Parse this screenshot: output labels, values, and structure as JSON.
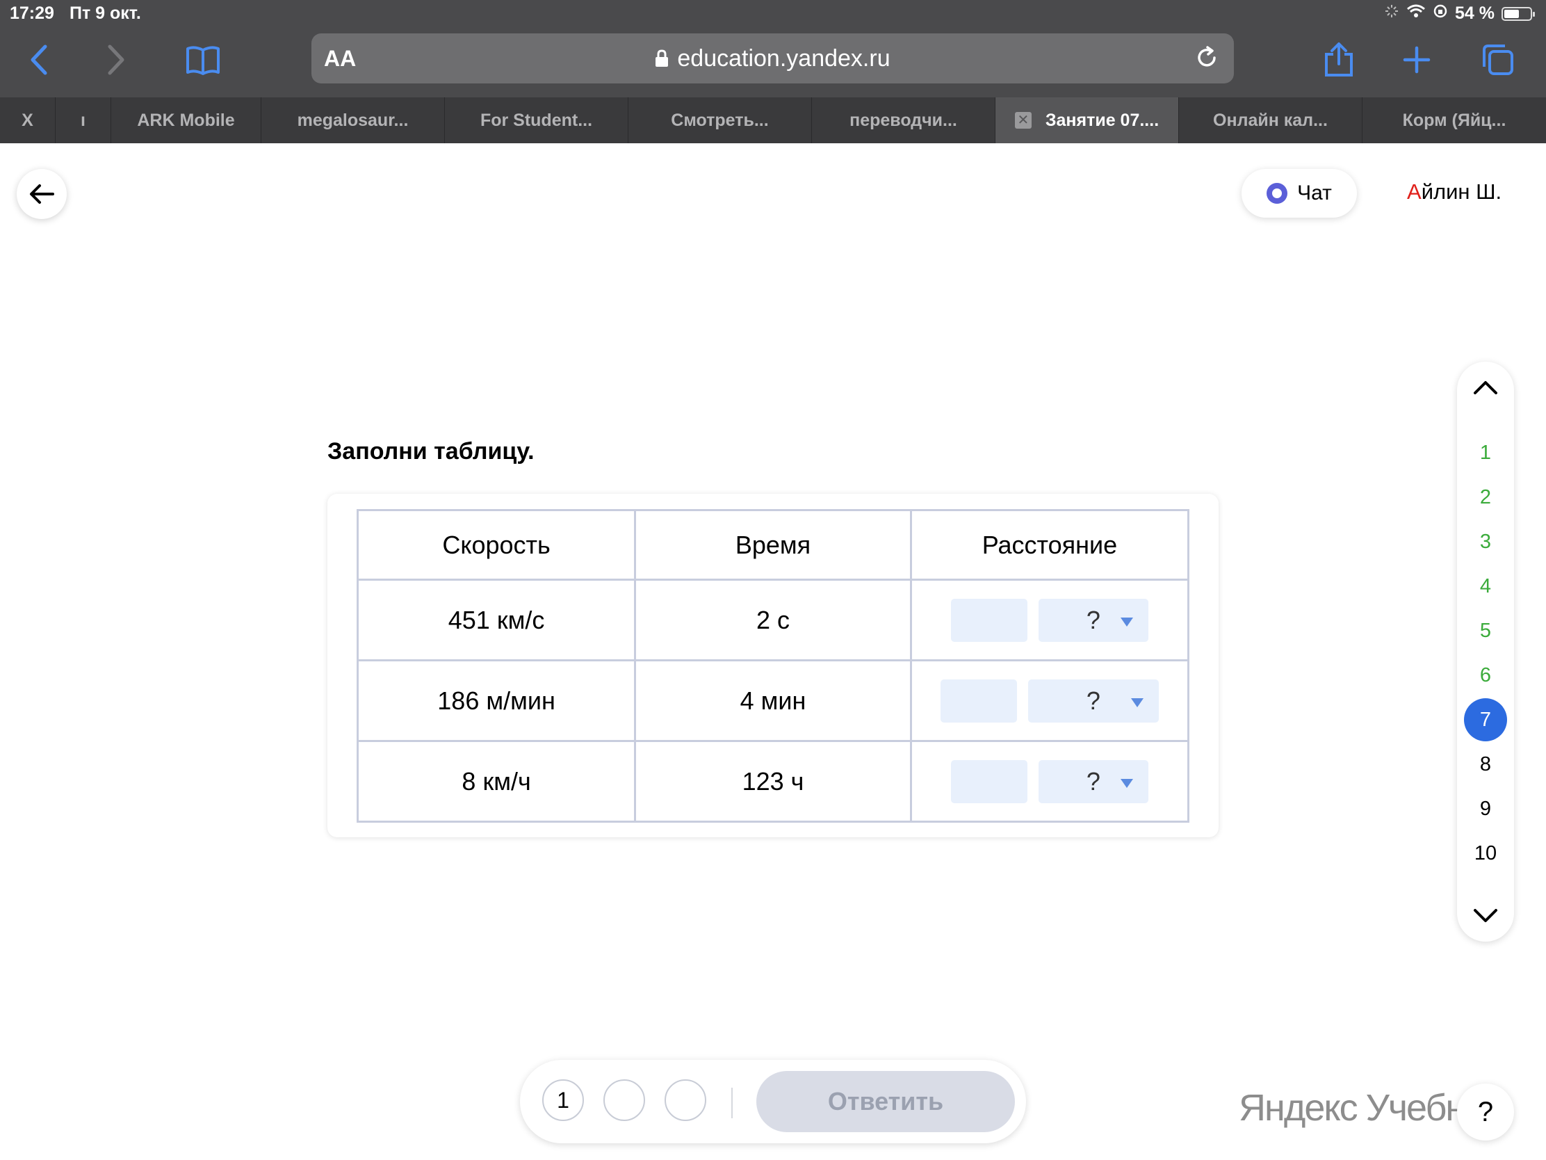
{
  "status": {
    "time": "17:29",
    "date": "Пт 9 окт.",
    "battery": "54 %"
  },
  "toolbar": {
    "text_size": "AA",
    "url": "education.yandex.ru"
  },
  "tabs": [
    {
      "label": "ARK Mobile"
    },
    {
      "label": "megalosaur..."
    },
    {
      "label": "For Student..."
    },
    {
      "label": "Смотреть..."
    },
    {
      "label": "переводчи..."
    },
    {
      "label": "Занятие 07...."
    },
    {
      "label": "Онлайн кал..."
    },
    {
      "label": "Корм (Яйц..."
    }
  ],
  "header": {
    "chat_label": "Чат",
    "user_first_letter": "А",
    "user_rest": "йлин Ш."
  },
  "task": {
    "title": "Заполни таблицу.",
    "columns": [
      "Скорость",
      "Время",
      "Расстояние"
    ],
    "rows": [
      {
        "speed": "451 км/с",
        "time": "2 с",
        "unit_placeholder": "?"
      },
      {
        "speed": "186 м/мин",
        "time": "4 мин",
        "unit_placeholder": "?"
      },
      {
        "speed": "8 км/ч",
        "time": "123 ч",
        "unit_placeholder": "?"
      }
    ]
  },
  "sidenav": {
    "items": [
      "1",
      "2",
      "3",
      "4",
      "5",
      "6",
      "7",
      "8",
      "9",
      "10"
    ],
    "current": "7"
  },
  "bottom": {
    "step1": "1",
    "answer_label": "Ответить"
  },
  "brand": "Яндекс Учебник",
  "help_label": "?",
  "colors": {
    "done": "#3bab3b",
    "current": "#2c6be0",
    "accent_red": "#e0201a"
  }
}
